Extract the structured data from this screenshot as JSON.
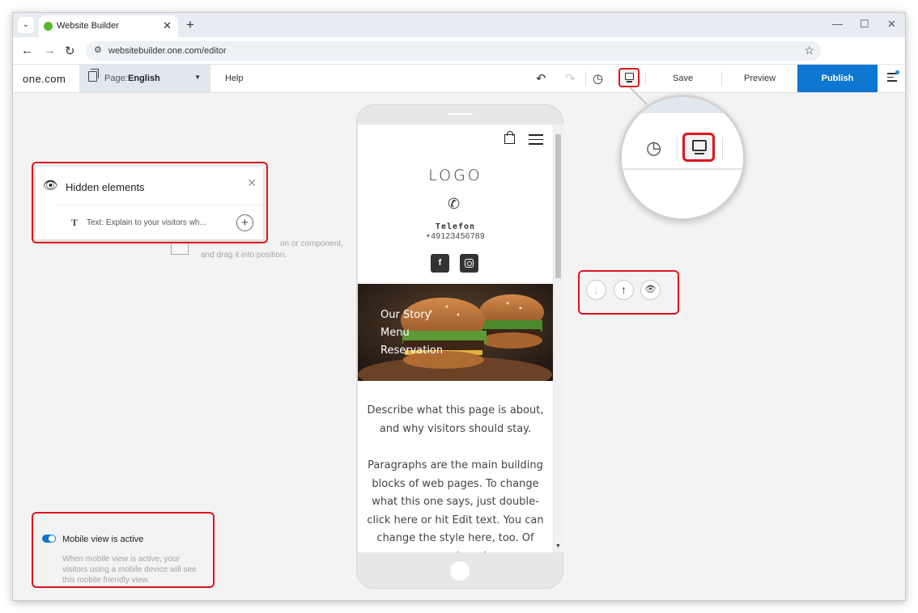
{
  "browser": {
    "tab_title": "Website Builder",
    "url": "websitebuilder.one.com/editor"
  },
  "editor": {
    "logo": "one.com",
    "page_prefix": "Page:",
    "page_value": "English",
    "help": "Help",
    "save": "Save",
    "preview": "Preview",
    "publish": "Publish"
  },
  "hidden_elements": {
    "title": "Hidden elements",
    "item_text": "Text: Explain to your visitors wh..."
  },
  "canvas_hint": {
    "line1": "on or component,",
    "line2": "and drag it into position."
  },
  "mobile_view": {
    "title": "Mobile view is active",
    "description": "When mobile view is active, your visitors using a mobile device will see this mobile friendly view."
  },
  "phone": {
    "logo": "LOGO",
    "telefon_label": "Telefon",
    "phone_number": "+49123456789",
    "menu": [
      "Our Story",
      "Menu",
      "Reservation"
    ],
    "intro": "Describe what this page is about, and why visitors should stay.",
    "paragraph": "Paragraphs are the main building blocks of web pages. To change what this one says, just double-click here or hit Edit text. You can change the style here, too. Of course, dragging"
  },
  "colors": {
    "accent": "#0d77d2",
    "highlight": "#e0141c"
  },
  "icons": [
    "history-icon",
    "desktop-view-icon",
    "undo-icon",
    "redo-icon",
    "eye-icon",
    "instagram-icon",
    "facebook-icon",
    "shopping-bag-icon",
    "phone-icon"
  ]
}
